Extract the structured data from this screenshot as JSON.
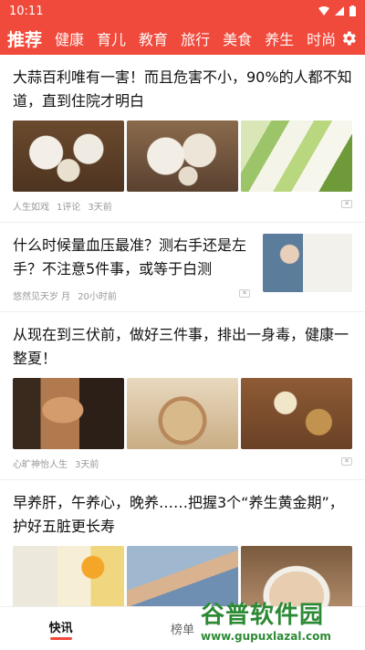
{
  "status": {
    "time": "10:11"
  },
  "tabs": [
    "推荐",
    "健康",
    "育儿",
    "教育",
    "旅行",
    "美食",
    "养生",
    "时尚"
  ],
  "articles": [
    {
      "title": "大蒜百利唯有一害！而且危害不小，90%的人都不知道，直到住院才明白",
      "author": "人生如戏",
      "comments": "1评论",
      "time": "3天前",
      "images": [
        "garlic-bulbs",
        "garlic-cloves",
        "leek-stalks"
      ]
    },
    {
      "title": "什么时候量血压最准？测右手还是左手？不注意5件事，或等于白测",
      "author": "悠然见天岁 月",
      "time": "20小时前",
      "images": [
        "doctor-blood-pressure"
      ]
    },
    {
      "title": "从现在到三伏前，做好三件事，排出一身毒，健康一整夏！",
      "author": "心旷神怡人生",
      "time": "3天前",
      "images": [
        "woman-portrait",
        "soup-bowl",
        "ginger-tea"
      ]
    },
    {
      "title": "早养肝，午养心，晚养……把握3个“养生黄金期”，护好五脏更长寿",
      "images": [
        "milk-drinks",
        "man-sleeping",
        "foot-soak"
      ]
    }
  ],
  "bottom_nav": {
    "tab1": "快讯",
    "tab2": "榜单"
  },
  "watermark": {
    "title": "谷普软件园",
    "url": "www.gupuxlazal.com"
  }
}
